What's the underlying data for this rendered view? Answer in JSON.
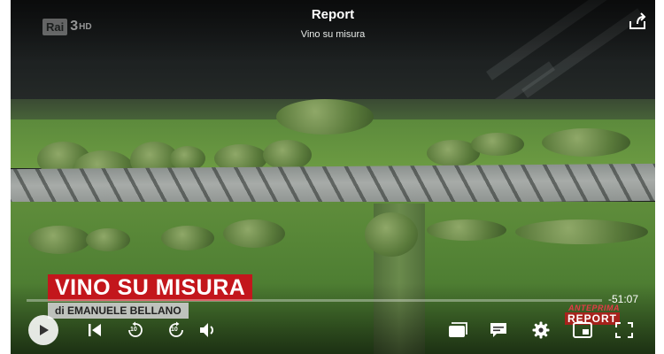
{
  "header": {
    "title": "Report",
    "subtitle": "Vino su misura",
    "channel_logo": {
      "brand": "Rai",
      "number": "3",
      "suffix": "HD"
    }
  },
  "overlay": {
    "program_title": "VINO SU MISURA",
    "author_line": "di EMANUELE BELLANO",
    "promo_top": "ANTEPRIMA",
    "promo_main": "REPORT"
  },
  "player": {
    "time_remaining": "-51:07",
    "progress_fraction": 0.0,
    "rewind_seconds": "10",
    "forward_seconds": "10"
  },
  "controls": {
    "icons": [
      "play-icon",
      "skip-previous-icon",
      "rewind-10-icon",
      "forward-10-icon",
      "volume-icon",
      "episodes-icon",
      "subtitles-icon",
      "settings-icon",
      "picture-in-picture-icon",
      "fullscreen-icon",
      "share-icon"
    ]
  },
  "colors": {
    "accent_red": "#c3161c",
    "control_white": "#ffffff"
  }
}
